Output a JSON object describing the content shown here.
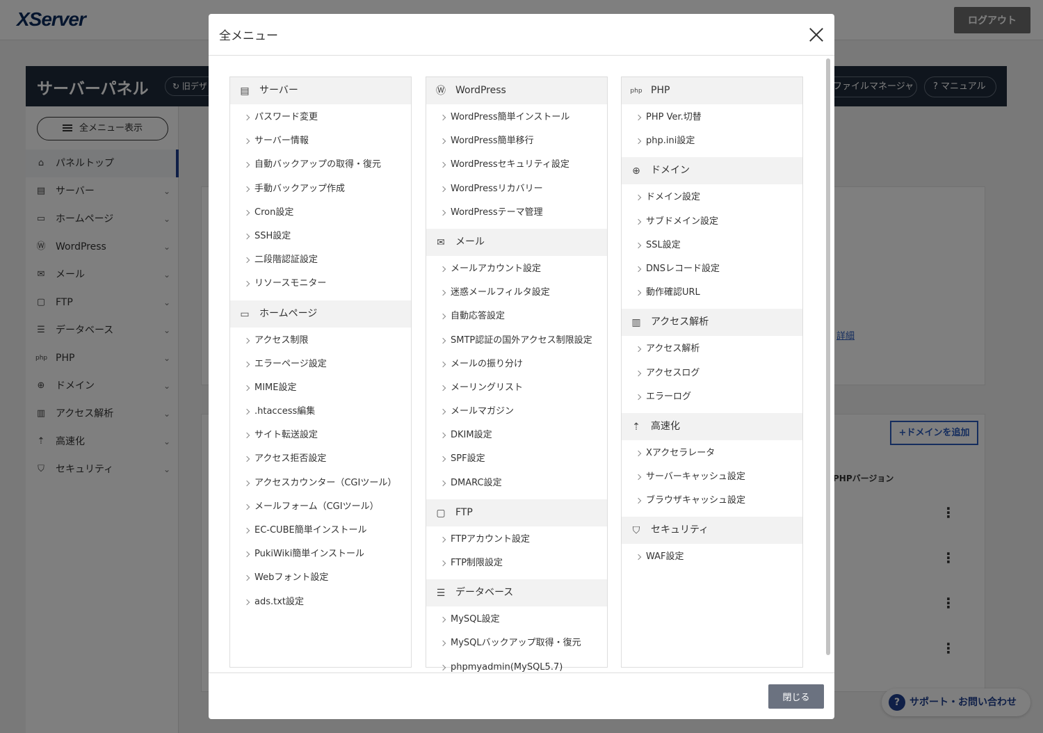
{
  "header": {
    "logo": "XServer",
    "logout_label": "ログアウト"
  },
  "panelbar": {
    "title": "サーバーパネル",
    "old_design": "旧デザ",
    "file_manager": "ファイルマネージャ",
    "manual": "マニュアル"
  },
  "sidebar": {
    "allmenu_label": "全メニュー表示",
    "items": [
      {
        "label": "パネルトップ",
        "icon": "home-icon"
      },
      {
        "label": "サーバー",
        "icon": "server-icon"
      },
      {
        "label": "ホームページ",
        "icon": "browser-icon"
      },
      {
        "label": "WordPress",
        "icon": "wordpress-icon"
      },
      {
        "label": "メール",
        "icon": "mail-icon"
      },
      {
        "label": "FTP",
        "icon": "ftp-icon"
      },
      {
        "label": "データベース",
        "icon": "database-icon"
      },
      {
        "label": "PHP",
        "icon": "php-icon"
      },
      {
        "label": "ドメイン",
        "icon": "globe-icon"
      },
      {
        "label": "アクセス解析",
        "icon": "analytics-icon"
      },
      {
        "label": "高速化",
        "icon": "speed-icon"
      },
      {
        "label": "セキュリティ",
        "icon": "shield-icon"
      }
    ]
  },
  "main": {
    "add_domain": "+ドメインを追加",
    "php_version_col": "PHPバージョン",
    "detail_link": "詳細",
    "support": "サポート・お問い合わせ"
  },
  "modal": {
    "title": "全メニュー",
    "close_label": "閉じる",
    "sections": {
      "server": {
        "title": "サーバー",
        "items": [
          "パスワード変更",
          "サーバー情報",
          "自動バックアップの取得・復元",
          "手動バックアップ作成",
          "Cron設定",
          "SSH設定",
          "二段階認証設定",
          "リソースモニター"
        ]
      },
      "homepage": {
        "title": "ホームページ",
        "items": [
          "アクセス制限",
          "エラーページ設定",
          "MIME設定",
          ".htaccess編集",
          "サイト転送設定",
          "アクセス拒否設定",
          "アクセスカウンター（CGIツール）",
          "メールフォーム（CGIツール）",
          "EC-CUBE簡単インストール",
          "PukiWiki簡単インストール",
          "Webフォント設定",
          "ads.txt設定"
        ]
      },
      "wordpress": {
        "title": "WordPress",
        "items": [
          "WordPress簡単インストール",
          "WordPress簡単移行",
          "WordPressセキュリティ設定",
          "WordPressリカバリー",
          "WordPressテーマ管理"
        ]
      },
      "mail": {
        "title": "メール",
        "items": [
          "メールアカウント設定",
          "迷惑メールフィルタ設定",
          "自動応答設定",
          "SMTP認証の国外アクセス制限設定",
          "メールの振り分け",
          "メーリングリスト",
          "メールマガジン",
          "DKIM設定",
          "SPF設定",
          "DMARC設定"
        ]
      },
      "ftp": {
        "title": "FTP",
        "items": [
          "FTPアカウント設定",
          "FTP制限設定"
        ]
      },
      "database": {
        "title": "データベース",
        "items": [
          "MySQL設定",
          "MySQLバックアップ取得・復元",
          "phpmyadmin(MySQL5.7)"
        ]
      },
      "php": {
        "title": "PHP",
        "items": [
          "PHP Ver.切替",
          "php.ini設定"
        ]
      },
      "domain": {
        "title": "ドメイン",
        "items": [
          "ドメイン設定",
          "サブドメイン設定",
          "SSL設定",
          "DNSレコード設定",
          "動作確認URL"
        ]
      },
      "analytics": {
        "title": "アクセス解析",
        "items": [
          "アクセス解析",
          "アクセスログ",
          "エラーログ"
        ]
      },
      "speed": {
        "title": "高速化",
        "items": [
          "Xアクセラレータ",
          "サーバーキャッシュ設定",
          "ブラウザキャッシュ設定"
        ]
      },
      "security": {
        "title": "セキュリティ",
        "items": [
          "WAF設定"
        ]
      }
    }
  }
}
